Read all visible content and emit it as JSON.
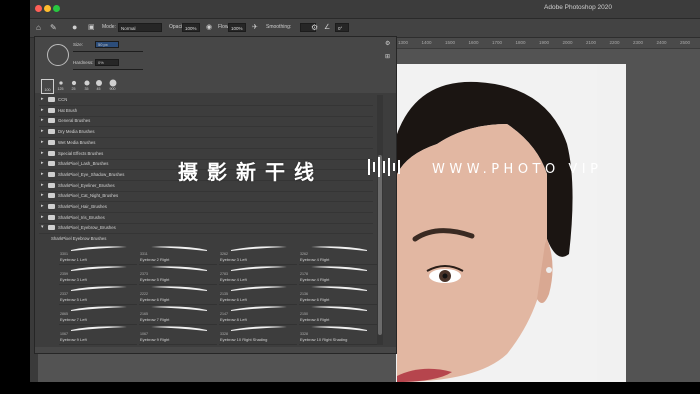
{
  "app": {
    "title": "Adobe Photoshop 2020"
  },
  "options_bar": {
    "mode_label": "Mode:",
    "mode_value": "Normal",
    "opacity_label": "Opacity:",
    "opacity_value": "100%",
    "flow_label": "Flow:",
    "flow_value": "100%",
    "smoothing_label": "Smoothing:",
    "angle_value": "0°"
  },
  "ruler": {
    "ticks": [
      "1300",
      "1400",
      "1500",
      "1600",
      "1700",
      "1800",
      "1900",
      "2000",
      "2100",
      "2200",
      "2300",
      "2400",
      "2500"
    ]
  },
  "brush_panel": {
    "size_label": "Size:",
    "size_value": "50 px",
    "hardness_label": "Hardness:",
    "hardness_value": "0%",
    "presets": [
      "100",
      "125",
      "25",
      "35",
      "45",
      "900"
    ],
    "folders": [
      "CCN",
      "Hat Brush",
      "General Brushes",
      "Dry Media Brushes",
      "Wet Media Brushes",
      "Special Effects Brushes",
      "SharkPixel_Lash_Brushes",
      "SharkPixel_Eye_Shadow_Brushes",
      "SharkPixel_Eyeliner_Brushes",
      "SharkPixel_Cat_Night_Brushes",
      "SharkPixel_Hair_Brushes",
      "SharkPixel_Iris_Brushes",
      "SharkPixel_Eyebrow_Brushes"
    ],
    "open_folder": "SharkPixel Eyebrow Brushes",
    "brushes": [
      {
        "num": "3301",
        "label": "Eyebrow 1 Left"
      },
      {
        "num": "3311",
        "label": "Eyebrow 2 Right"
      },
      {
        "num": "3262",
        "label": "Eyebrow 3 Left"
      },
      {
        "num": "3262",
        "label": "Eyebrow 4 Right"
      },
      {
        "num": "2359",
        "label": "Eyebrow 3 Left"
      },
      {
        "num": "2373",
        "label": "Eyebrow 5 Right"
      },
      {
        "num": "2783",
        "label": "Eyebrow 4 Left"
      },
      {
        "num": "2178",
        "label": "Eyebrow 4 Right"
      },
      {
        "num": "2337",
        "label": "Eyebrow 5 Left"
      },
      {
        "num": "2222",
        "label": "Eyebrow 6 Right"
      },
      {
        "num": "2135",
        "label": "Eyebrow 6 Left"
      },
      {
        "num": "2136",
        "label": "Eyebrow 6 Right"
      },
      {
        "num": "2865",
        "label": "Eyebrow 7 Left"
      },
      {
        "num": "2165",
        "label": "Eyebrow 7 Right"
      },
      {
        "num": "2147",
        "label": "Eyebrow 8 Left"
      },
      {
        "num": "2150",
        "label": "Eyebrow 8 Right"
      },
      {
        "num": "1067",
        "label": "Eyebrow 9 Left"
      },
      {
        "num": "1067",
        "label": "Eyebrow 9 Right"
      },
      {
        "num": "3328",
        "label": "Eyebrow 10 Right Shading"
      },
      {
        "num": "3328",
        "label": "Eyebrow 10 Right Shading"
      }
    ]
  },
  "watermark": {
    "cn": "摄影新干线",
    "site": "WWW.PHOTO    VIP"
  }
}
